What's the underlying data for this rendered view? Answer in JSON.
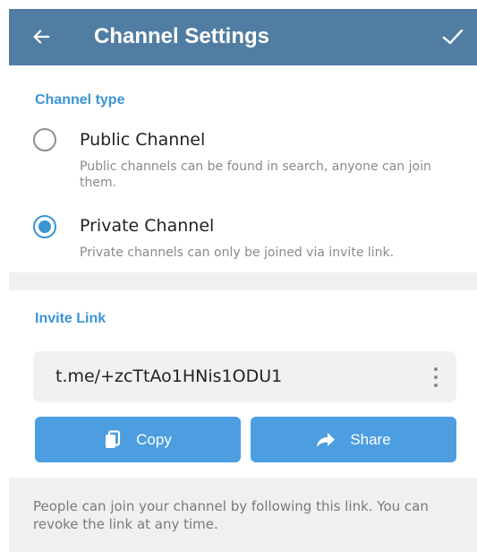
{
  "header": {
    "title": "Channel Settings",
    "back_icon": "arrow-left-icon",
    "done_icon": "checkmark-icon",
    "background": "#517da2"
  },
  "channel_type": {
    "section_title": "Channel type",
    "options": [
      {
        "title": "Public Channel",
        "description": "Public channels can be found in search, anyone can join them.",
        "selected": false
      },
      {
        "title": "Private Channel",
        "description": "Private channels can only be joined via invite link.",
        "selected": true
      }
    ]
  },
  "invite_link": {
    "section_title": "Invite Link",
    "link": "t.me/+zcTtAo1HNis1ODU1",
    "more_icon": "more-vertical-icon",
    "copy_label": "Copy",
    "copy_icon": "copy-icon",
    "share_label": "Share",
    "share_icon": "share-arrow-icon",
    "footer": "People can join your channel by following this link. You can revoke the link at any time."
  },
  "colors": {
    "accent": "#3a95d5",
    "button": "#4c9ee0"
  }
}
